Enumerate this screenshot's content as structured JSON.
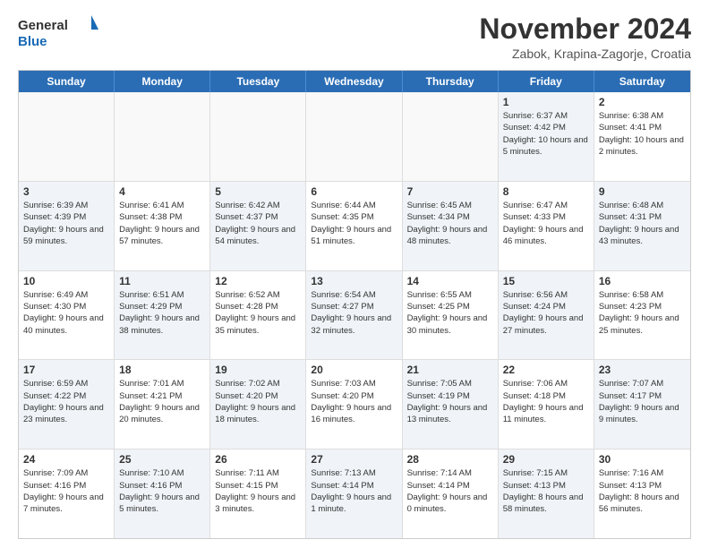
{
  "logo": {
    "general": "General",
    "blue": "Blue"
  },
  "header": {
    "month": "November 2024",
    "location": "Zabok, Krapina-Zagorje, Croatia"
  },
  "days_of_week": [
    "Sunday",
    "Monday",
    "Tuesday",
    "Wednesday",
    "Thursday",
    "Friday",
    "Saturday"
  ],
  "rows": [
    [
      {
        "day": "",
        "info": "",
        "empty": true
      },
      {
        "day": "",
        "info": "",
        "empty": true
      },
      {
        "day": "",
        "info": "",
        "empty": true
      },
      {
        "day": "",
        "info": "",
        "empty": true
      },
      {
        "day": "",
        "info": "",
        "empty": true
      },
      {
        "day": "1",
        "info": "Sunrise: 6:37 AM\nSunset: 4:42 PM\nDaylight: 10 hours and 5 minutes.",
        "empty": false,
        "shaded": true
      },
      {
        "day": "2",
        "info": "Sunrise: 6:38 AM\nSunset: 4:41 PM\nDaylight: 10 hours and 2 minutes.",
        "empty": false,
        "shaded": false
      }
    ],
    [
      {
        "day": "3",
        "info": "Sunrise: 6:39 AM\nSunset: 4:39 PM\nDaylight: 9 hours and 59 minutes.",
        "empty": false,
        "shaded": true
      },
      {
        "day": "4",
        "info": "Sunrise: 6:41 AM\nSunset: 4:38 PM\nDaylight: 9 hours and 57 minutes.",
        "empty": false,
        "shaded": false
      },
      {
        "day": "5",
        "info": "Sunrise: 6:42 AM\nSunset: 4:37 PM\nDaylight: 9 hours and 54 minutes.",
        "empty": false,
        "shaded": true
      },
      {
        "day": "6",
        "info": "Sunrise: 6:44 AM\nSunset: 4:35 PM\nDaylight: 9 hours and 51 minutes.",
        "empty": false,
        "shaded": false
      },
      {
        "day": "7",
        "info": "Sunrise: 6:45 AM\nSunset: 4:34 PM\nDaylight: 9 hours and 48 minutes.",
        "empty": false,
        "shaded": true
      },
      {
        "day": "8",
        "info": "Sunrise: 6:47 AM\nSunset: 4:33 PM\nDaylight: 9 hours and 46 minutes.",
        "empty": false,
        "shaded": false
      },
      {
        "day": "9",
        "info": "Sunrise: 6:48 AM\nSunset: 4:31 PM\nDaylight: 9 hours and 43 minutes.",
        "empty": false,
        "shaded": true
      }
    ],
    [
      {
        "day": "10",
        "info": "Sunrise: 6:49 AM\nSunset: 4:30 PM\nDaylight: 9 hours and 40 minutes.",
        "empty": false,
        "shaded": false
      },
      {
        "day": "11",
        "info": "Sunrise: 6:51 AM\nSunset: 4:29 PM\nDaylight: 9 hours and 38 minutes.",
        "empty": false,
        "shaded": true
      },
      {
        "day": "12",
        "info": "Sunrise: 6:52 AM\nSunset: 4:28 PM\nDaylight: 9 hours and 35 minutes.",
        "empty": false,
        "shaded": false
      },
      {
        "day": "13",
        "info": "Sunrise: 6:54 AM\nSunset: 4:27 PM\nDaylight: 9 hours and 32 minutes.",
        "empty": false,
        "shaded": true
      },
      {
        "day": "14",
        "info": "Sunrise: 6:55 AM\nSunset: 4:25 PM\nDaylight: 9 hours and 30 minutes.",
        "empty": false,
        "shaded": false
      },
      {
        "day": "15",
        "info": "Sunrise: 6:56 AM\nSunset: 4:24 PM\nDaylight: 9 hours and 27 minutes.",
        "empty": false,
        "shaded": true
      },
      {
        "day": "16",
        "info": "Sunrise: 6:58 AM\nSunset: 4:23 PM\nDaylight: 9 hours and 25 minutes.",
        "empty": false,
        "shaded": false
      }
    ],
    [
      {
        "day": "17",
        "info": "Sunrise: 6:59 AM\nSunset: 4:22 PM\nDaylight: 9 hours and 23 minutes.",
        "empty": false,
        "shaded": true
      },
      {
        "day": "18",
        "info": "Sunrise: 7:01 AM\nSunset: 4:21 PM\nDaylight: 9 hours and 20 minutes.",
        "empty": false,
        "shaded": false
      },
      {
        "day": "19",
        "info": "Sunrise: 7:02 AM\nSunset: 4:20 PM\nDaylight: 9 hours and 18 minutes.",
        "empty": false,
        "shaded": true
      },
      {
        "day": "20",
        "info": "Sunrise: 7:03 AM\nSunset: 4:20 PM\nDaylight: 9 hours and 16 minutes.",
        "empty": false,
        "shaded": false
      },
      {
        "day": "21",
        "info": "Sunrise: 7:05 AM\nSunset: 4:19 PM\nDaylight: 9 hours and 13 minutes.",
        "empty": false,
        "shaded": true
      },
      {
        "day": "22",
        "info": "Sunrise: 7:06 AM\nSunset: 4:18 PM\nDaylight: 9 hours and 11 minutes.",
        "empty": false,
        "shaded": false
      },
      {
        "day": "23",
        "info": "Sunrise: 7:07 AM\nSunset: 4:17 PM\nDaylight: 9 hours and 9 minutes.",
        "empty": false,
        "shaded": true
      }
    ],
    [
      {
        "day": "24",
        "info": "Sunrise: 7:09 AM\nSunset: 4:16 PM\nDaylight: 9 hours and 7 minutes.",
        "empty": false,
        "shaded": false
      },
      {
        "day": "25",
        "info": "Sunrise: 7:10 AM\nSunset: 4:16 PM\nDaylight: 9 hours and 5 minutes.",
        "empty": false,
        "shaded": true
      },
      {
        "day": "26",
        "info": "Sunrise: 7:11 AM\nSunset: 4:15 PM\nDaylight: 9 hours and 3 minutes.",
        "empty": false,
        "shaded": false
      },
      {
        "day": "27",
        "info": "Sunrise: 7:13 AM\nSunset: 4:14 PM\nDaylight: 9 hours and 1 minute.",
        "empty": false,
        "shaded": true
      },
      {
        "day": "28",
        "info": "Sunrise: 7:14 AM\nSunset: 4:14 PM\nDaylight: 9 hours and 0 minutes.",
        "empty": false,
        "shaded": false
      },
      {
        "day": "29",
        "info": "Sunrise: 7:15 AM\nSunset: 4:13 PM\nDaylight: 8 hours and 58 minutes.",
        "empty": false,
        "shaded": true
      },
      {
        "day": "30",
        "info": "Sunrise: 7:16 AM\nSunset: 4:13 PM\nDaylight: 8 hours and 56 minutes.",
        "empty": false,
        "shaded": false
      }
    ]
  ]
}
